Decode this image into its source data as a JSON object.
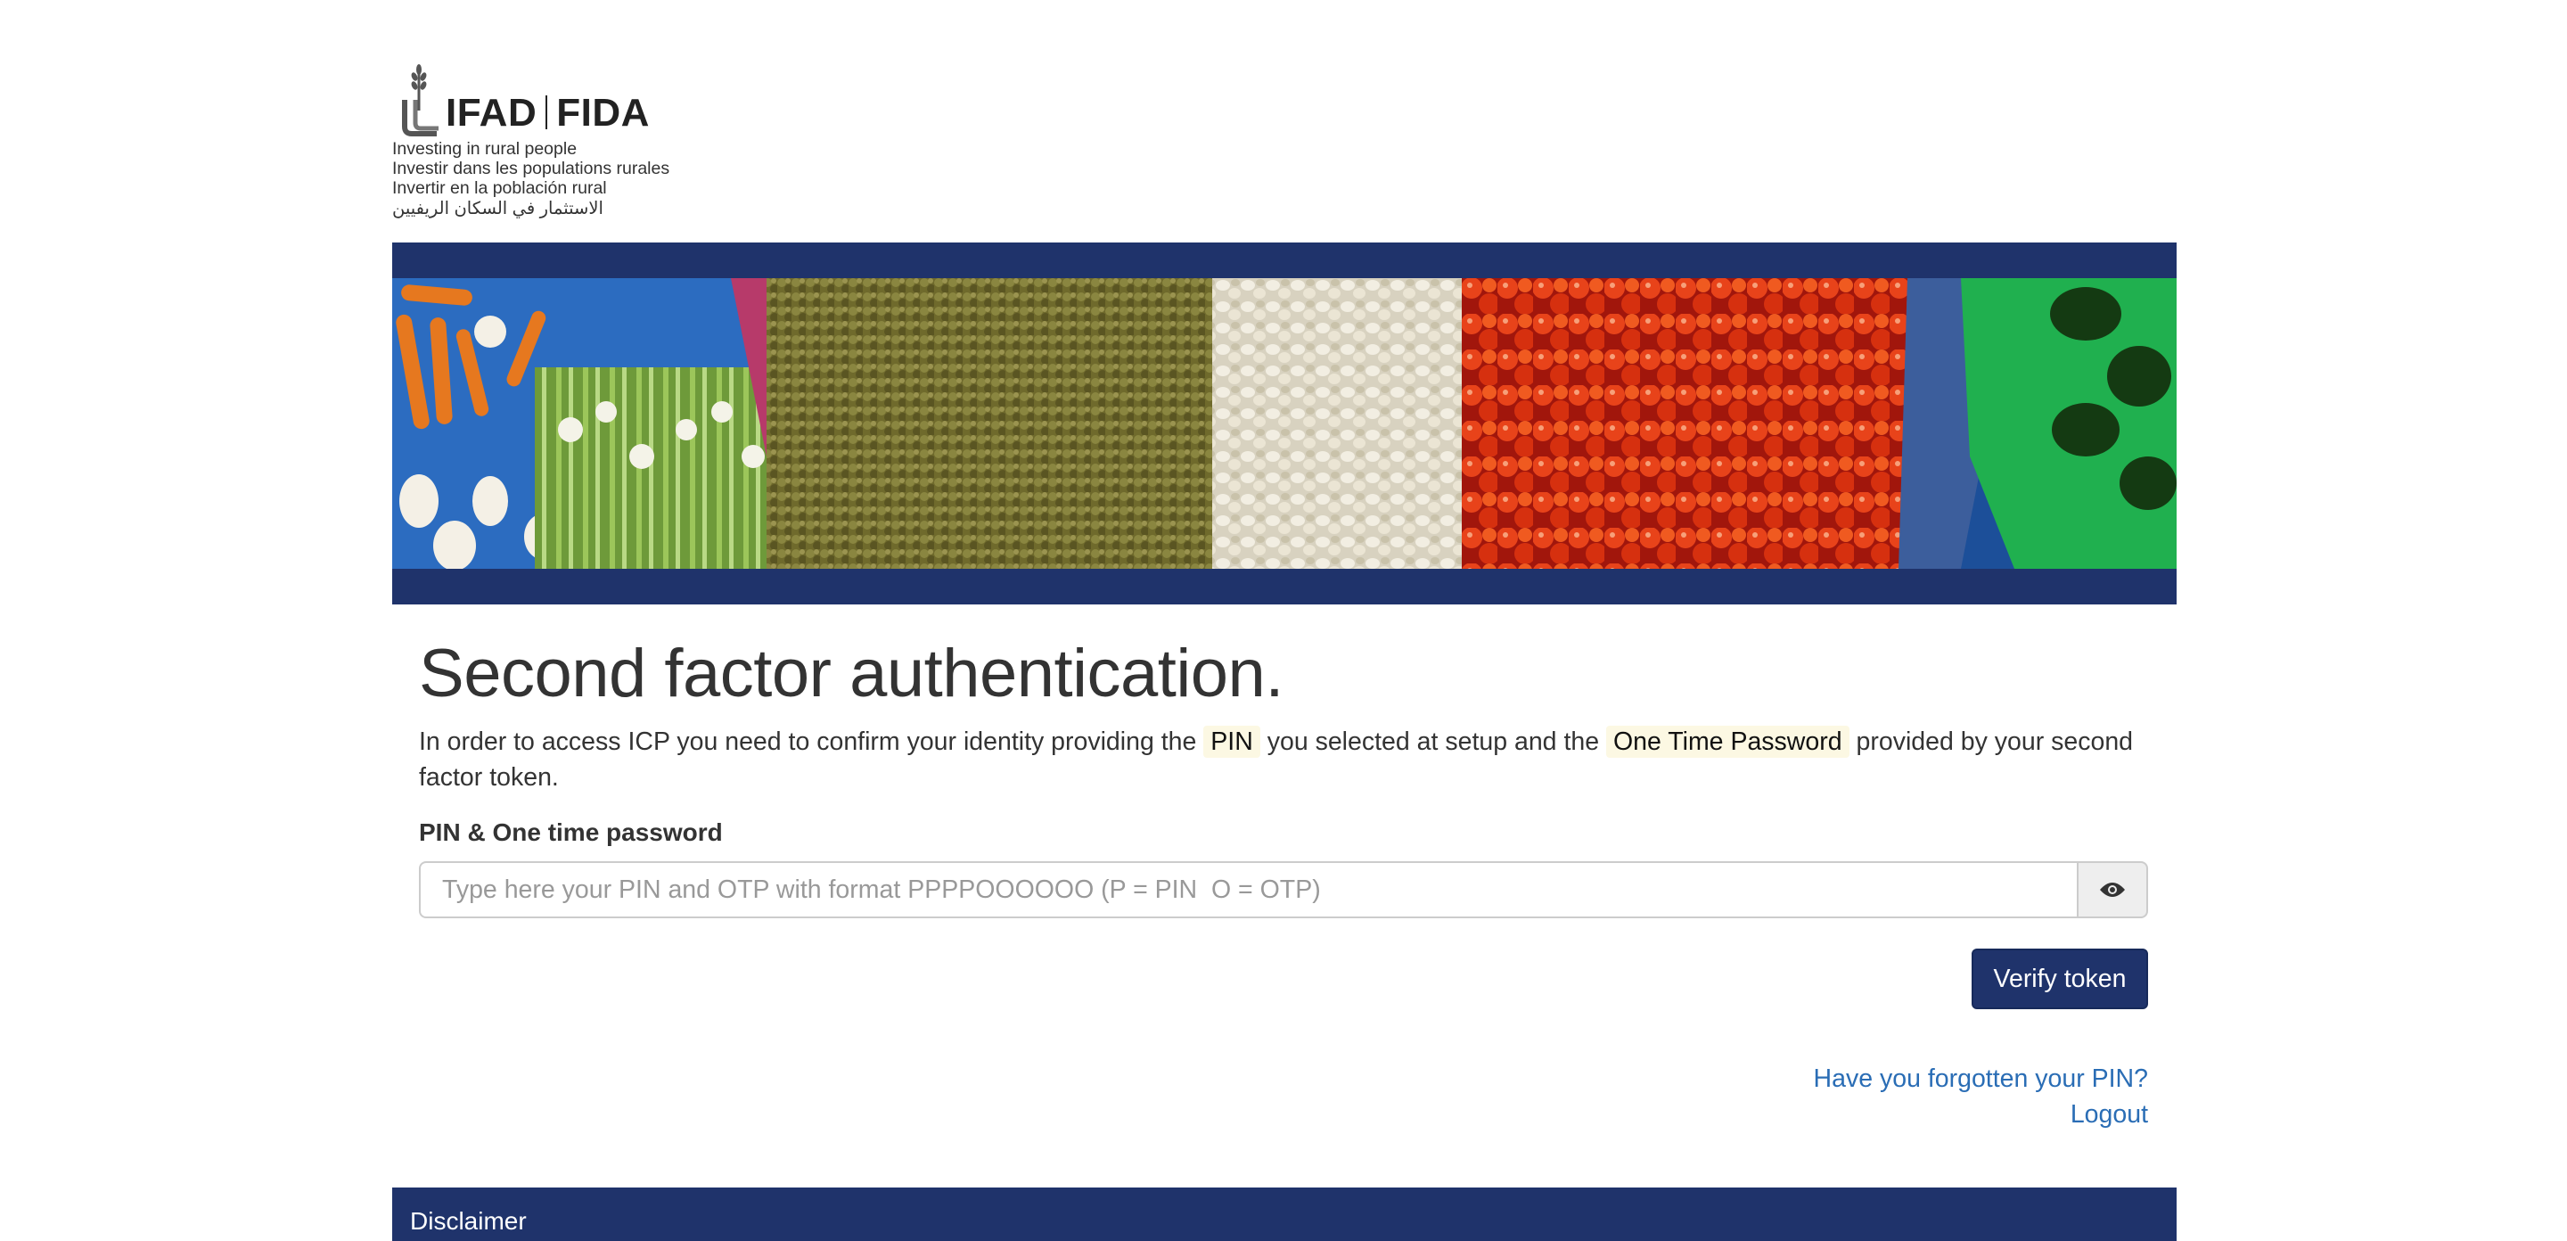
{
  "logo": {
    "wordmark_left": "IFAD",
    "wordmark_right": "FIDA",
    "taglines": [
      "Investing in rural people",
      "Investir dans les populations rurales",
      "Invertir en la población rural",
      "الاستثمار في السكان الريفيين"
    ]
  },
  "banner": {
    "produce": [
      "carrots",
      "spring onions",
      "lentils",
      "garlic",
      "tomatoes",
      "green peppers"
    ]
  },
  "main": {
    "title": "Second factor authentication.",
    "intro_part1": "In order to access ICP you need to confirm your identity providing the ",
    "intro_pin": "PIN",
    "intro_part2": " you selected at setup and the ",
    "intro_otp": "One Time Password",
    "intro_part3": " provided by your second factor token.",
    "field_label": "PIN & One time password",
    "input_value": "",
    "input_placeholder": "Type here your PIN and OTP with format PPPPOOOOOO (P = PIN  O = OTP)",
    "toggle_visibility_icon": "eye-icon",
    "verify_label": "Verify token",
    "forgot_pin_label": "Have you forgotten your PIN?",
    "logout_label": "Logout"
  },
  "footer": {
    "title": "Disclaimer"
  },
  "colors": {
    "brand_navy": "#1f336b",
    "link_blue": "#2a6db5",
    "highlight_bg": "#fcf8e3"
  }
}
